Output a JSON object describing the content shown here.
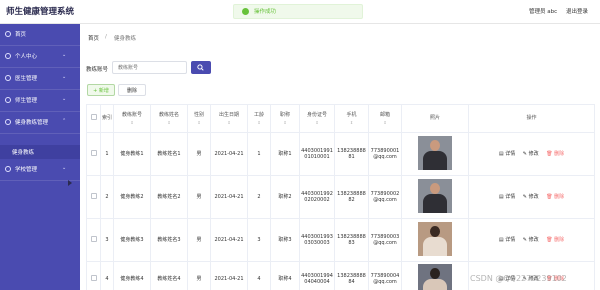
{
  "header": {
    "app_title": "师生健康管理系统",
    "toast": "操作成功",
    "admin_label": "管理员 abc",
    "logout_label": "退出登录"
  },
  "sidebar": {
    "items": [
      {
        "label": "首页",
        "icon": "home-icon"
      },
      {
        "label": "个人中心",
        "icon": "user-icon"
      },
      {
        "label": "医生管理",
        "icon": "doctor-icon"
      },
      {
        "label": "师生管理",
        "icon": "people-icon"
      },
      {
        "label": "健身教练管理",
        "icon": "coach-icon"
      },
      {
        "label": "学校管理",
        "icon": "school-icon"
      }
    ],
    "active_sub": "健身教练"
  },
  "breadcrumb": {
    "home": "首页",
    "separator": "/",
    "current": "健身教练"
  },
  "search": {
    "label": "教练账号",
    "placeholder": "教练账号"
  },
  "toolbar": {
    "add_label": "+ 新增",
    "delete_label": "删除"
  },
  "table": {
    "headers": {
      "index": "索引",
      "account": "教练账号",
      "name": "教练姓名",
      "gender": "性别",
      "birth": "出生日期",
      "years": "工龄",
      "title": "职称",
      "idcard": "身份证号",
      "phone": "手机",
      "email": "邮箱",
      "photo": "照片",
      "actions": "操作"
    },
    "rows": [
      {
        "index": "1",
        "account": "健身教练1",
        "name": "教练姓名1",
        "gender": "男",
        "birth": "2021-04-21",
        "years": "1",
        "title": "职称1",
        "idcard": "440300199101010001",
        "phone": "13823888881",
        "email": "773890001@qq.com"
      },
      {
        "index": "2",
        "account": "健身教练2",
        "name": "教练姓名2",
        "gender": "男",
        "birth": "2021-04-21",
        "years": "2",
        "title": "职称2",
        "idcard": "440300199202020002",
        "phone": "13823888882",
        "email": "773890002@qq.com"
      },
      {
        "index": "3",
        "account": "健身教练3",
        "name": "教练姓名3",
        "gender": "男",
        "birth": "2021-04-21",
        "years": "3",
        "title": "职称3",
        "idcard": "440300199303030003",
        "phone": "13823888883",
        "email": "773890003@qq.com"
      },
      {
        "index": "4",
        "account": "健身教练4",
        "name": "教练姓名4",
        "gender": "男",
        "birth": "2021-04-21",
        "years": "4",
        "title": "职称4",
        "idcard": "440300199404040004",
        "phone": "13823888884",
        "email": "773890004@qq.com"
      }
    ],
    "actions": {
      "view": "详情",
      "edit": "修改",
      "delete": "删除"
    }
  },
  "watermark": "CSDN @QQ2279239102"
}
